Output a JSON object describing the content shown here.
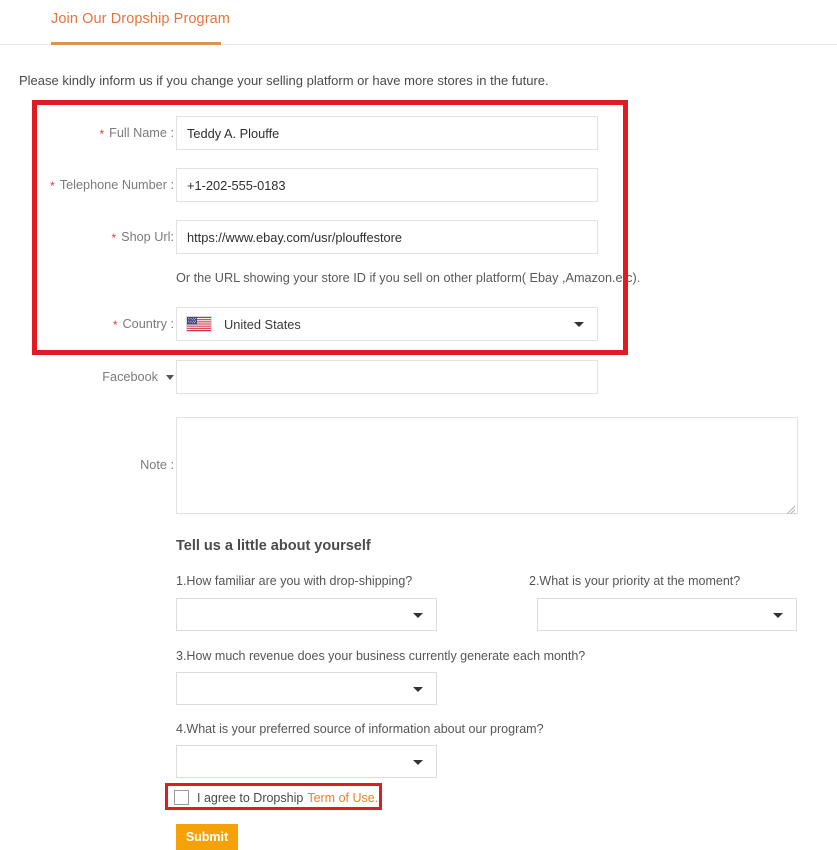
{
  "tab": {
    "label": "Join Our Dropship Program"
  },
  "intro": {
    "text": "Please kindly inform us if you change your selling platform or have more stores in the future."
  },
  "form": {
    "required_marker": "*",
    "fields": [
      {
        "id": "full_name",
        "label": "Full Name :",
        "required": true,
        "value": "Teddy A. Plouffe",
        "placeholder": ""
      },
      {
        "id": "telephone_number",
        "label": "Telephone Number :",
        "required": true,
        "value": "+1-202-555-0183",
        "placeholder": ""
      },
      {
        "id": "shop_url",
        "label": "Shop Url:",
        "required": true,
        "value": "https://www.ebay.com/usr/plouffestore",
        "placeholder": ""
      }
    ],
    "shop_url_hint": "Or the URL showing your store ID if you sell on other platform( Ebay ,Amazon.etc).",
    "country": {
      "label": "Country :",
      "required": true,
      "value": "United States",
      "flag": "us-flag-icon"
    },
    "facebook": {
      "label": "Facebook",
      "value": "",
      "placeholder": ""
    },
    "note": {
      "label": "Note :",
      "value": "",
      "placeholder": ""
    }
  },
  "about": {
    "title": "Tell us a little about yourself",
    "questions": [
      {
        "label": "1.How familiar are you with drop-shipping?",
        "value": ""
      },
      {
        "label": "2.What is your priority at the moment?",
        "value": ""
      },
      {
        "label": "3.How much revenue does your business currently generate each month?",
        "value": ""
      },
      {
        "label": "4.What is your preferred source of information about our program?",
        "value": ""
      }
    ]
  },
  "terms": {
    "checked": false,
    "text": "I agree to Dropship",
    "link_text": "Term of Use."
  },
  "submit": {
    "label": "Submit"
  },
  "colors": {
    "accent_orange": "#e8743b",
    "tab_underline": "#d79650",
    "annotation_red": "#e11b22",
    "required_star": "#e4393c",
    "link_orange": "#f08020",
    "submit_bg": "#f5a209"
  }
}
